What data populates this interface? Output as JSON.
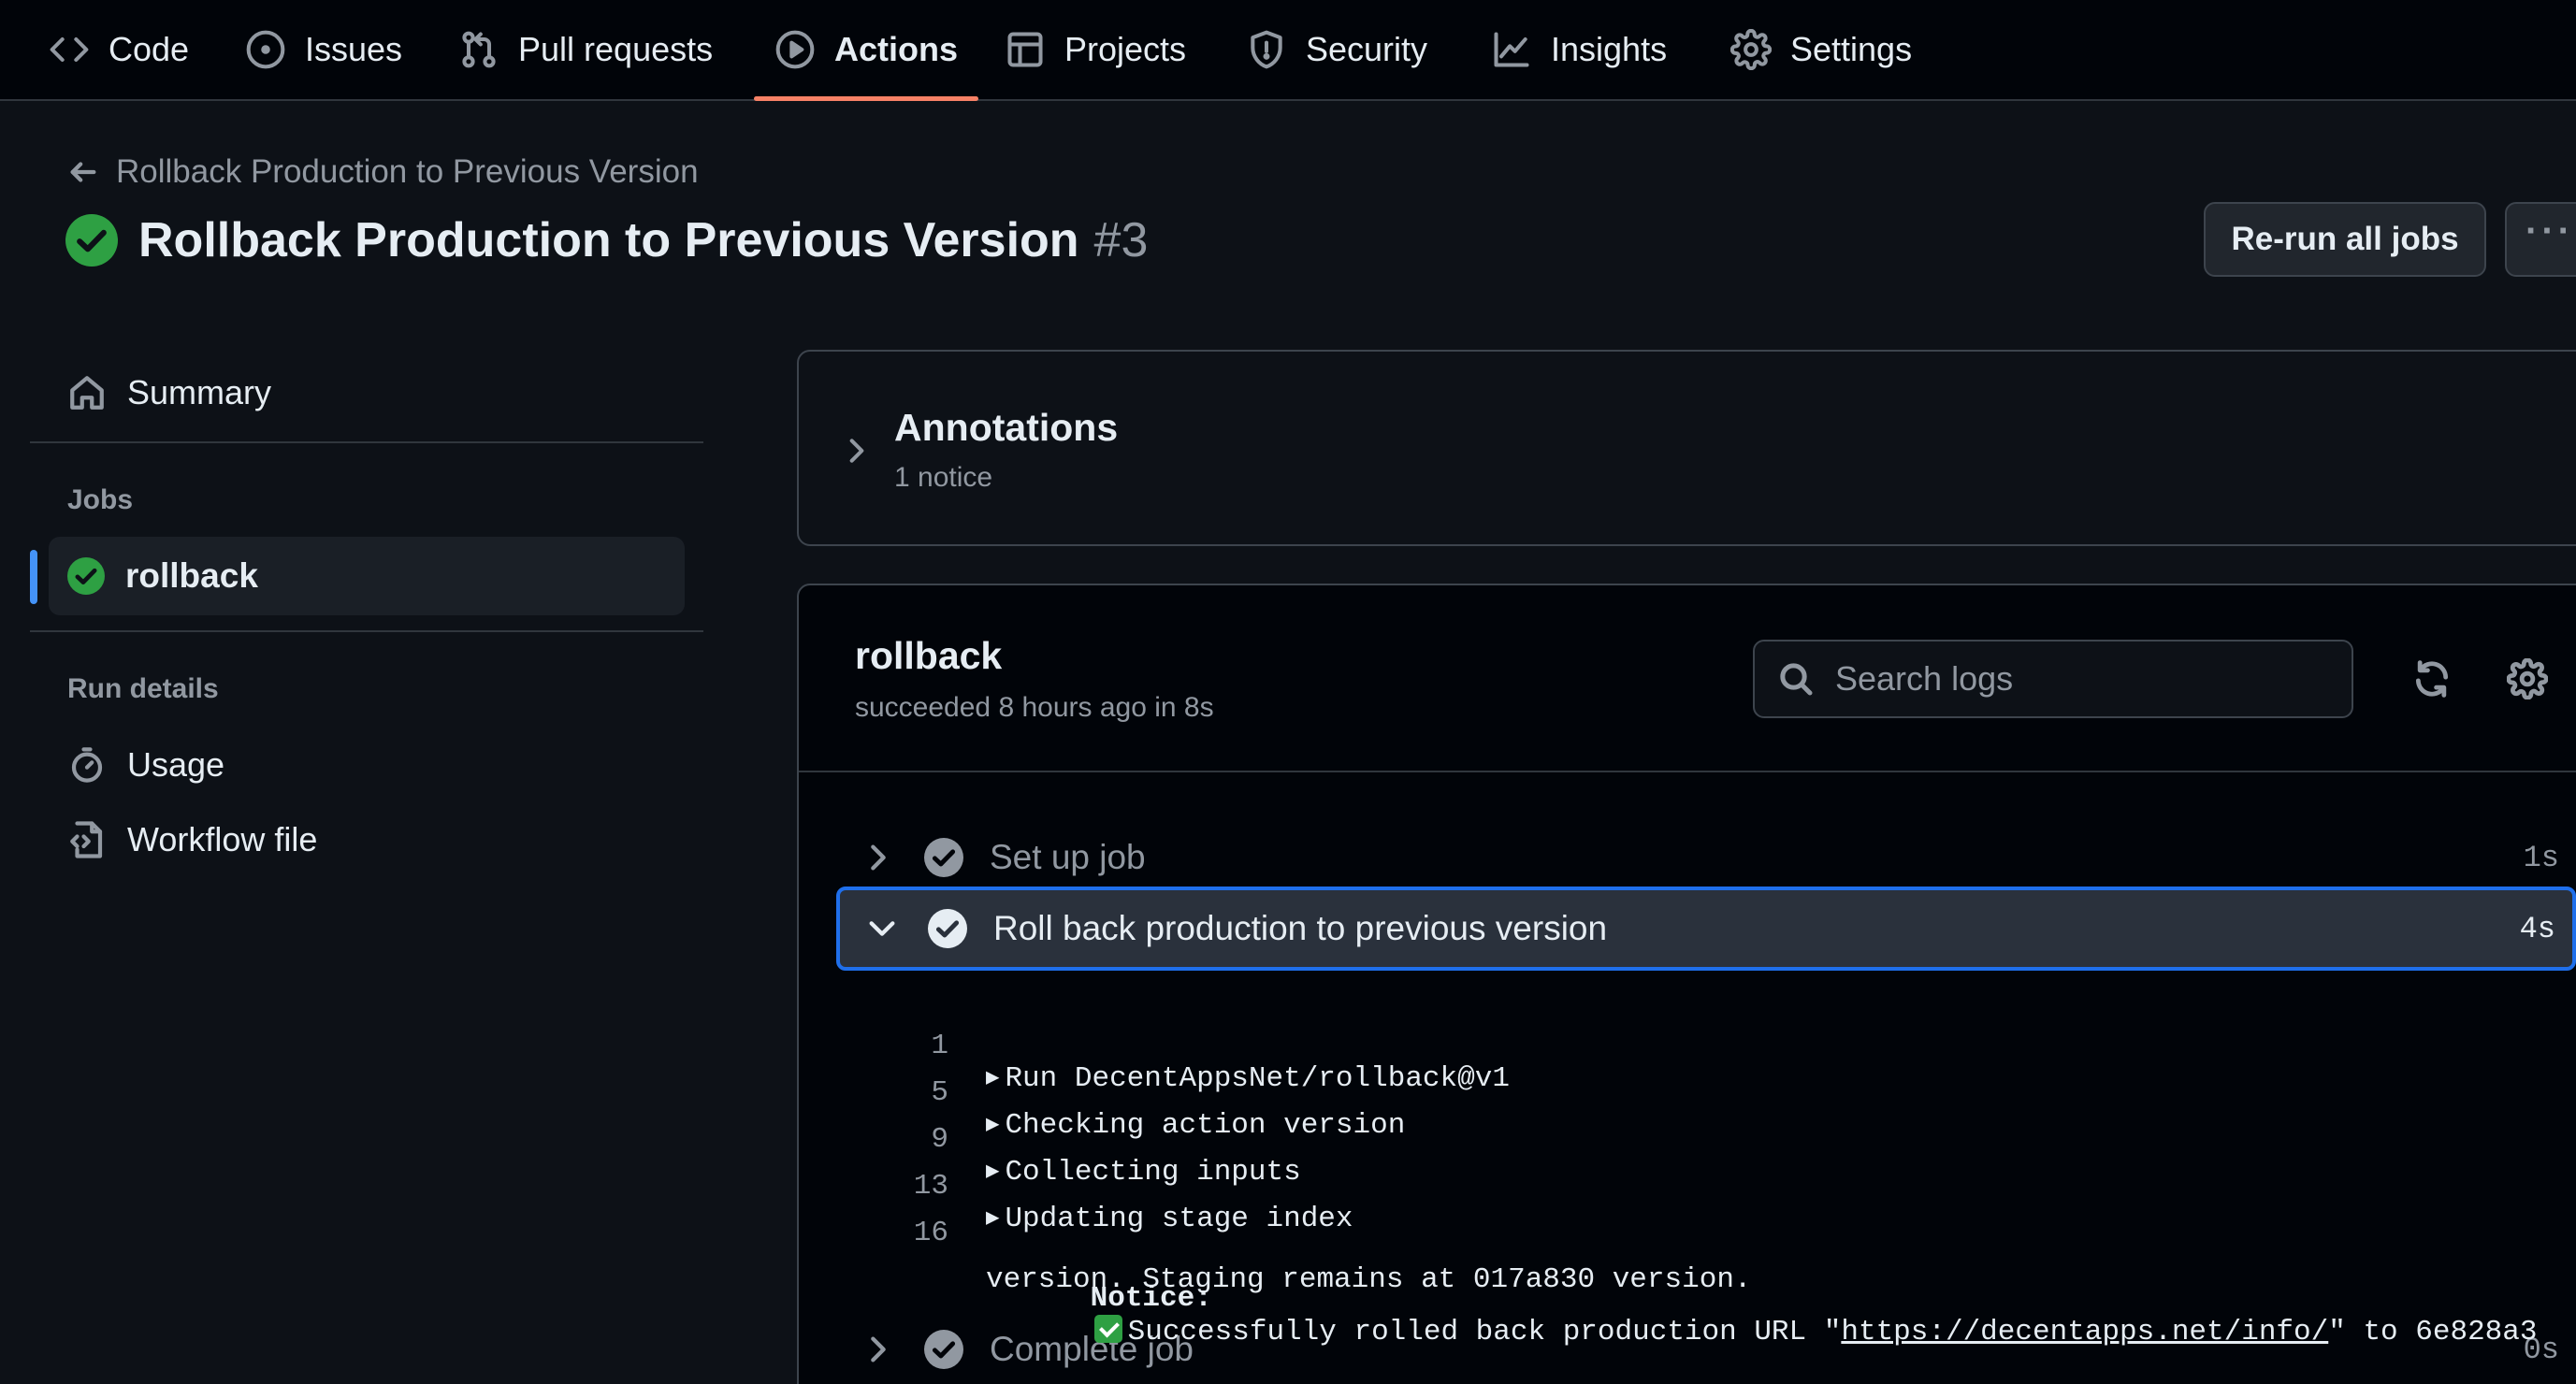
{
  "nav": {
    "tabs": [
      {
        "label": "Code",
        "icon": "code-icon"
      },
      {
        "label": "Issues",
        "icon": "issue-opened-icon"
      },
      {
        "label": "Pull requests",
        "icon": "git-pull-request-icon"
      },
      {
        "label": "Actions",
        "icon": "play-icon",
        "active": true
      },
      {
        "label": "Projects",
        "icon": "table-icon"
      },
      {
        "label": "Security",
        "icon": "shield-icon"
      },
      {
        "label": "Insights",
        "icon": "graph-icon"
      },
      {
        "label": "Settings",
        "icon": "gear-icon"
      }
    ]
  },
  "header": {
    "back_label": "Rollback Production to Previous Version",
    "title": "Rollback Production to Previous Version",
    "run_number": "#3",
    "status": "success",
    "rerun_label": "Re-run all jobs",
    "more_label": "···"
  },
  "sidebar": {
    "summary_label": "Summary",
    "jobs_heading": "Jobs",
    "jobs": [
      {
        "label": "rollback",
        "status": "success"
      }
    ],
    "run_details_heading": "Run details",
    "usage_label": "Usage",
    "workflow_file_label": "Workflow file"
  },
  "annotations": {
    "title": "Annotations",
    "count": "1 notice"
  },
  "job": {
    "name": "rollback",
    "status_text": "succeeded 8 hours ago in 8s",
    "search_placeholder": "Search logs",
    "steps": [
      {
        "label": "Set up job",
        "duration": "1s",
        "expanded": false
      },
      {
        "label": "Roll back production to previous version",
        "duration": "4s",
        "expanded": true
      },
      {
        "label": "Complete job",
        "duration": "0s",
        "expanded": false
      }
    ],
    "log": {
      "lines": [
        {
          "num": "1",
          "text": "Run DecentAppsNet/rollback@v1"
        },
        {
          "num": "5",
          "text": "Checking action version"
        },
        {
          "num": "9",
          "text": "Collecting inputs"
        },
        {
          "num": "13",
          "text": "Updating stage index"
        }
      ],
      "notice": {
        "num": "16",
        "label": "Notice:",
        "before": "Successfully rolled back production URL \"",
        "url": "https://decentapps.net/info/",
        "after": "\" to 6e828a3",
        "continuation": "version. Staging remains at 017a830 version."
      }
    }
  },
  "colors": {
    "background": "#0d1117",
    "nav_background": "#010409",
    "success": "#2ea043",
    "accent_underline": "#f78166",
    "focus_blue": "#1f6feb"
  }
}
